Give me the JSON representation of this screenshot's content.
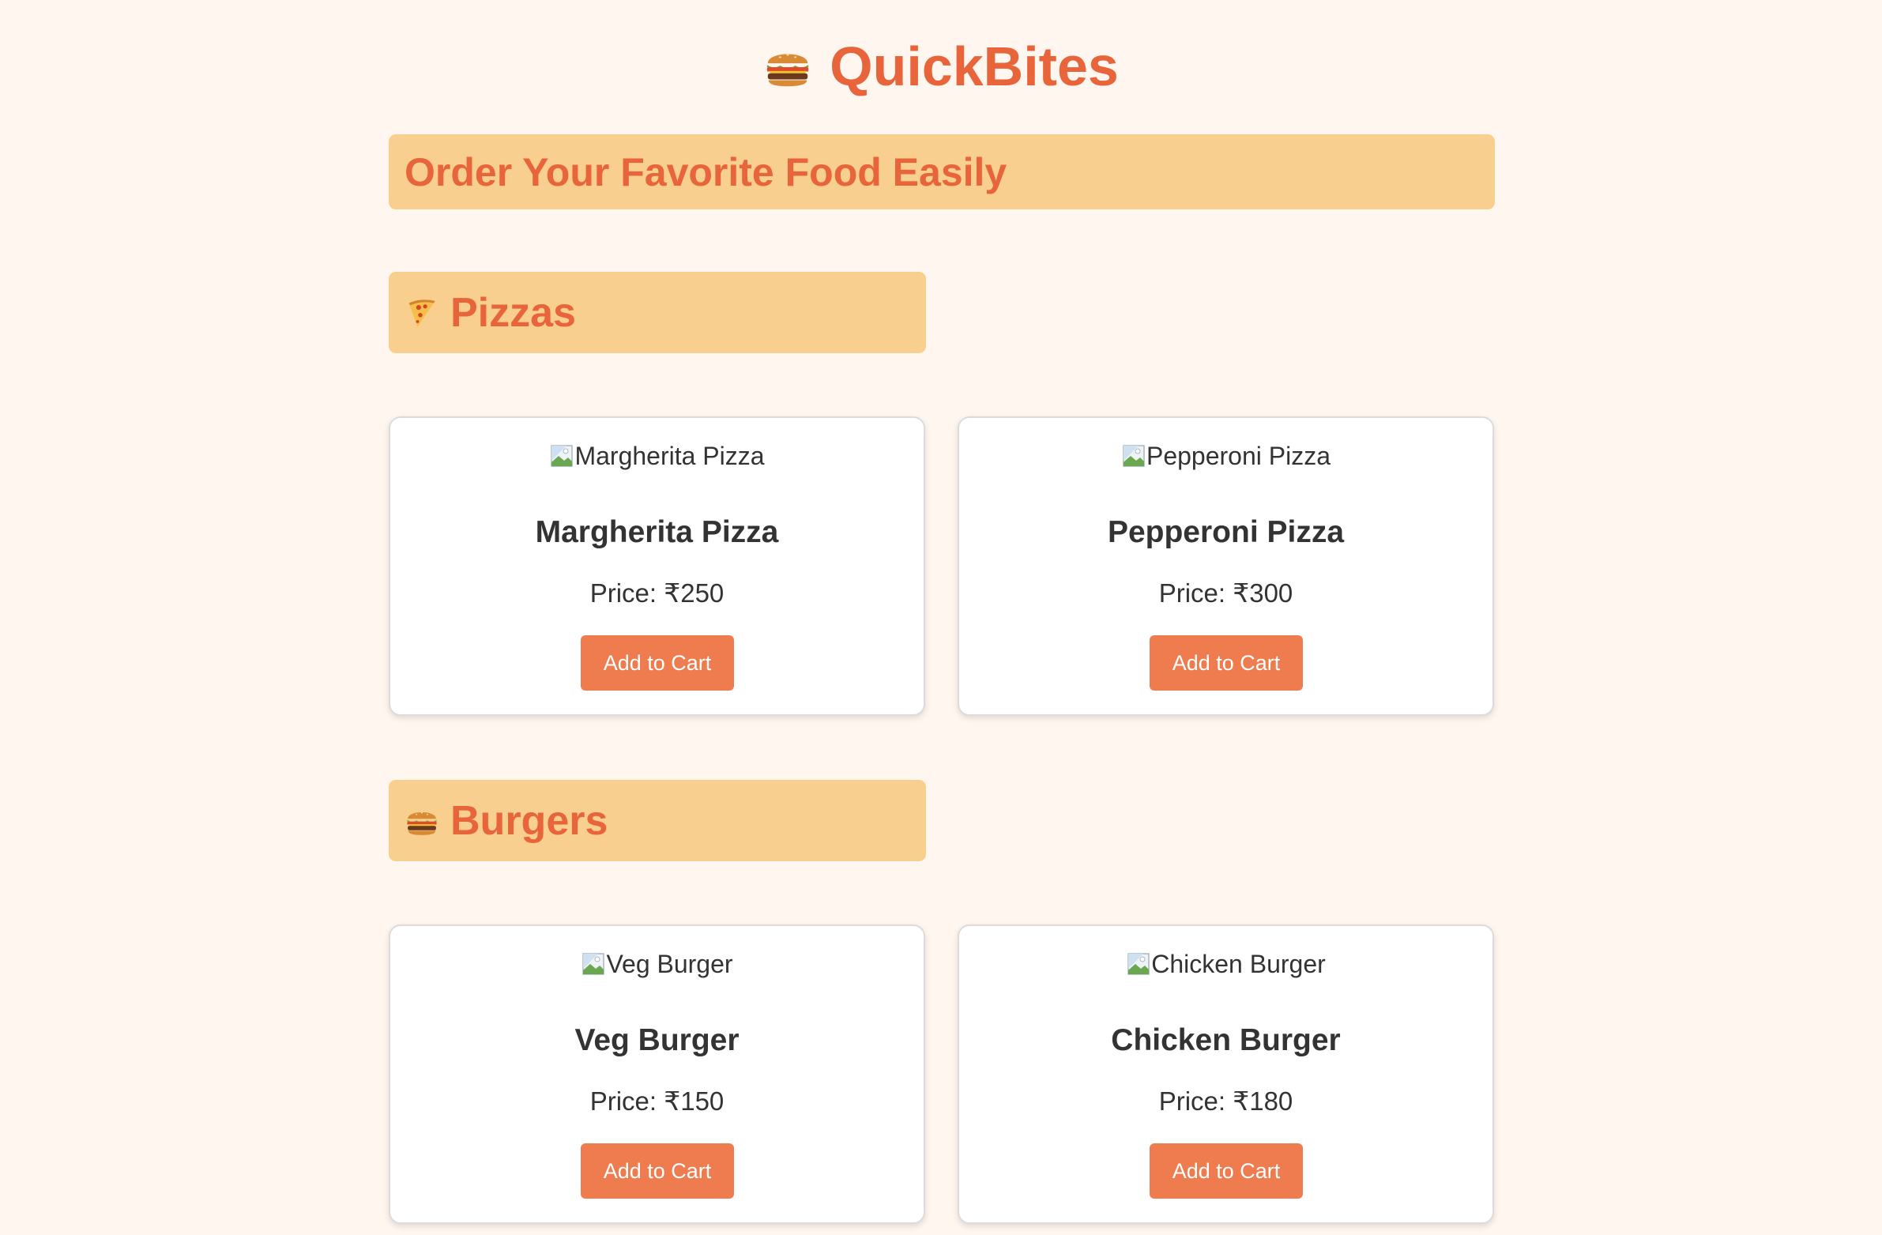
{
  "header": {
    "icon": "burger-icon",
    "title": "QuickBites"
  },
  "banner": {
    "text": "Order Your Favorite Food Easily"
  },
  "sections": [
    {
      "icon": "pizza-slice-icon",
      "title": "Pizzas",
      "items": [
        {
          "image_alt": "Margherita Pizza",
          "name": "Margherita Pizza",
          "price": "Price: ₹250",
          "button": "Add to Cart"
        },
        {
          "image_alt": "Pepperoni Pizza",
          "name": "Pepperoni Pizza",
          "price": "Price: ₹300",
          "button": "Add to Cart"
        }
      ]
    },
    {
      "icon": "burger-icon",
      "title": "Burgers",
      "items": [
        {
          "image_alt": "Veg Burger",
          "name": "Veg Burger",
          "price": "Price: ₹150",
          "button": "Add to Cart"
        },
        {
          "image_alt": "Chicken Burger",
          "name": "Chicken Burger",
          "price": "Price: ₹180",
          "button": "Add to Cart"
        }
      ]
    }
  ],
  "colors": {
    "background": "#fff6f0",
    "accent": "#e8643a",
    "button": "#ef7c4f",
    "section_bg": "#f8cf8e"
  }
}
